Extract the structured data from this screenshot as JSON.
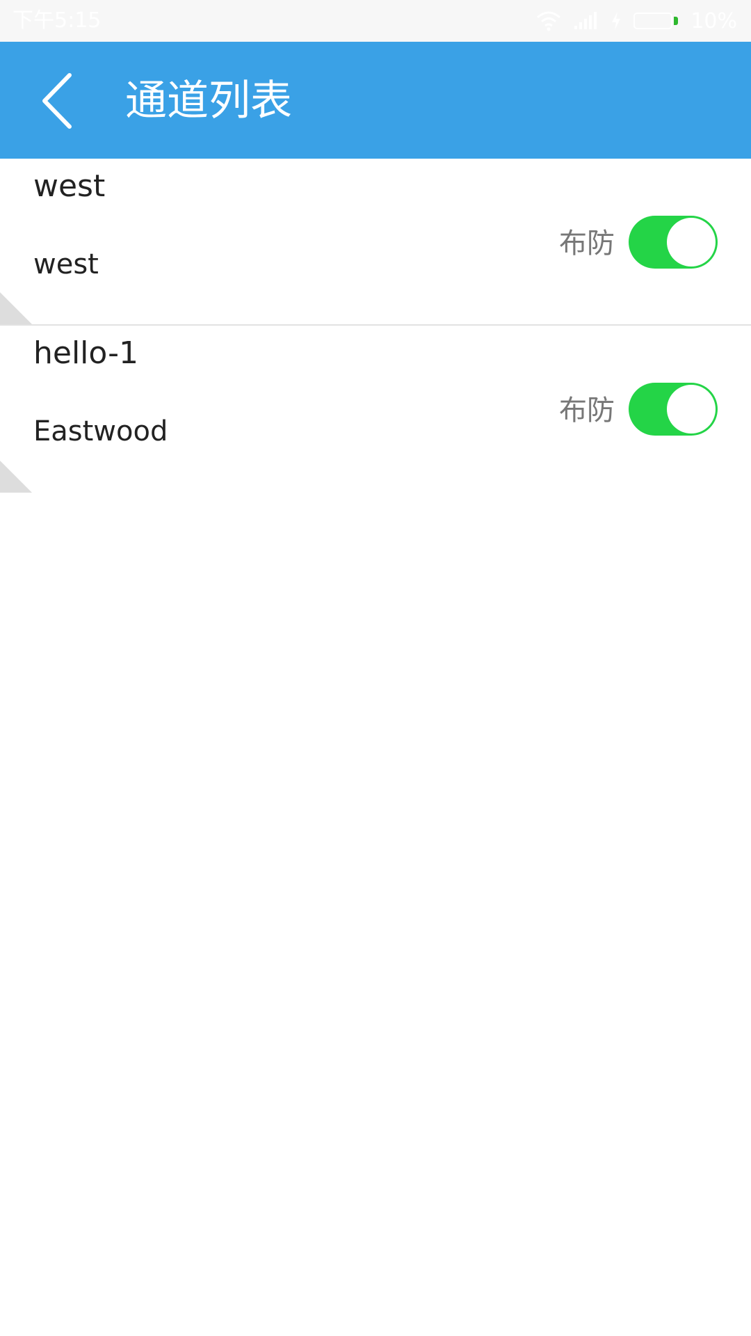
{
  "status_bar": {
    "time": "下午5:15",
    "battery_percent": "10%",
    "icons": [
      "wifi-icon",
      "signal-icon",
      "charging-icon",
      "battery-icon"
    ]
  },
  "app_bar": {
    "title": "通道列表",
    "back_icon": "chevron-left-icon",
    "color": "#3aa1e6"
  },
  "channels": [
    {
      "name": "west",
      "subtitle": "west",
      "arm_label": "布防",
      "armed": true
    },
    {
      "name": "hello-1",
      "subtitle": "Eastwood",
      "arm_label": "布防",
      "armed": true
    }
  ],
  "colors": {
    "toggle_on": "#24d447",
    "label_gray": "#777777",
    "text_dark": "#222222"
  }
}
